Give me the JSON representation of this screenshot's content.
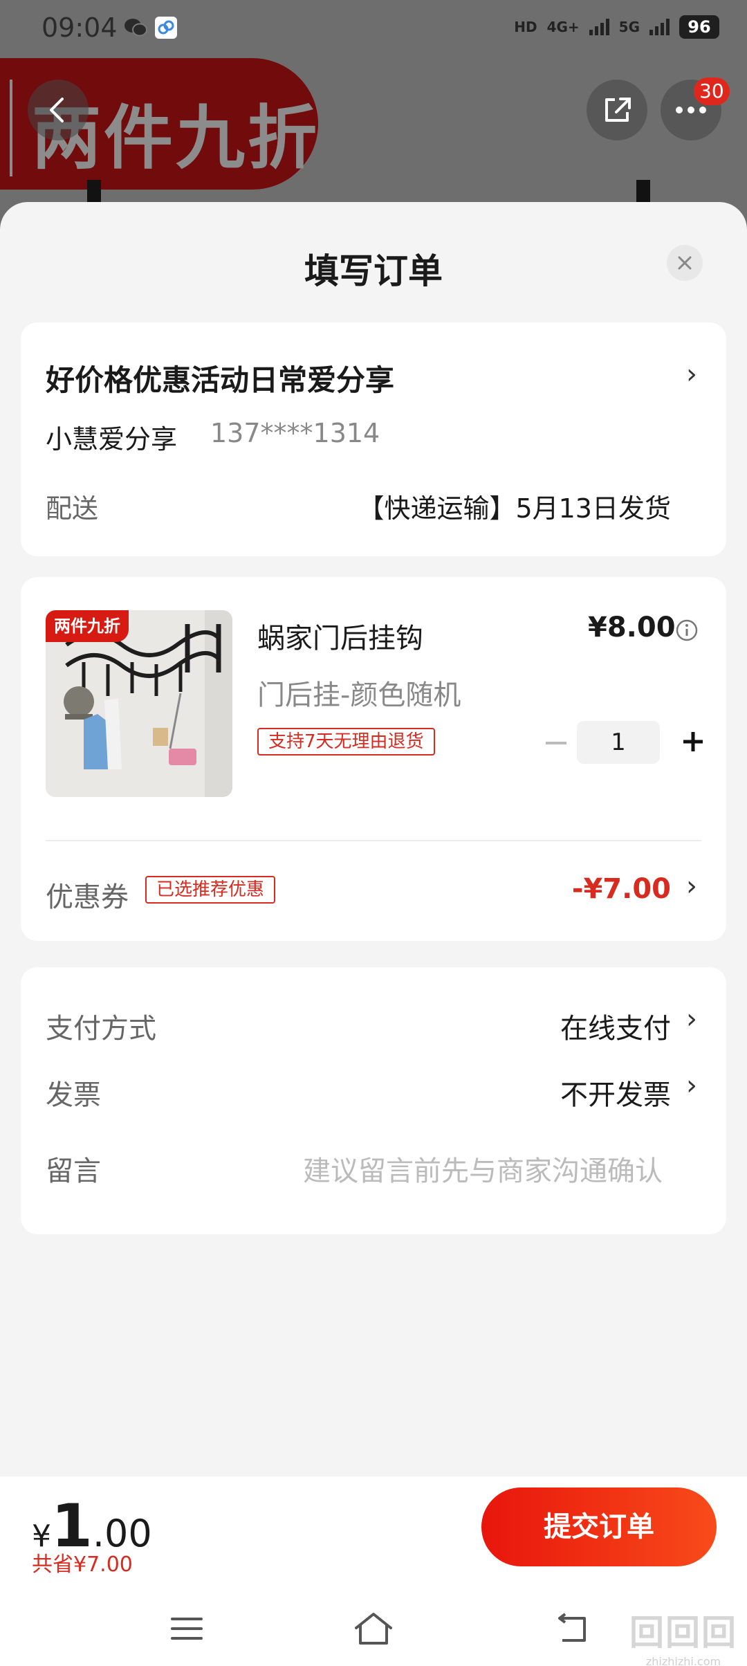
{
  "status_bar": {
    "time": "09:04",
    "network_hd": "HD",
    "network_4g": "4G+",
    "network_5g": "5G",
    "battery": "96"
  },
  "background": {
    "banner_text": "两件九折",
    "notification_count": "30"
  },
  "sheet": {
    "title": "填写订单"
  },
  "address": {
    "name": "好价格优惠活动日常爱分享",
    "receiver": "小慧爱分享",
    "phone": "137****1314",
    "shipping_label": "配送",
    "shipping_value": "【快递运输】5月13日发货"
  },
  "product": {
    "image_tag": "两件九折",
    "name": "蜗家门后挂钩",
    "price": "¥8.00",
    "spec": "门后挂-颜色随机",
    "return_policy": "支持7天无理由退货",
    "quantity": "1",
    "coupon_label": "优惠券",
    "coupon_tag": "已选推荐优惠",
    "coupon_amount": "-¥7.00"
  },
  "payment": {
    "method_label": "支付方式",
    "method_value": "在线支付",
    "invoice_label": "发票",
    "invoice_value": "不开发票",
    "message_label": "留言",
    "message_placeholder": "建议留言前先与商家沟通确认"
  },
  "bottom": {
    "currency": "¥",
    "total_int": "1",
    "total_dec": ".00",
    "saved": "共省¥7.00",
    "submit_label": "提交订单"
  },
  "watermark": {
    "text": "zhizhizhi.com"
  },
  "colors": {
    "accent": "#d72b1f",
    "button_start": "#e8160c",
    "button_end": "#f84b1a"
  }
}
